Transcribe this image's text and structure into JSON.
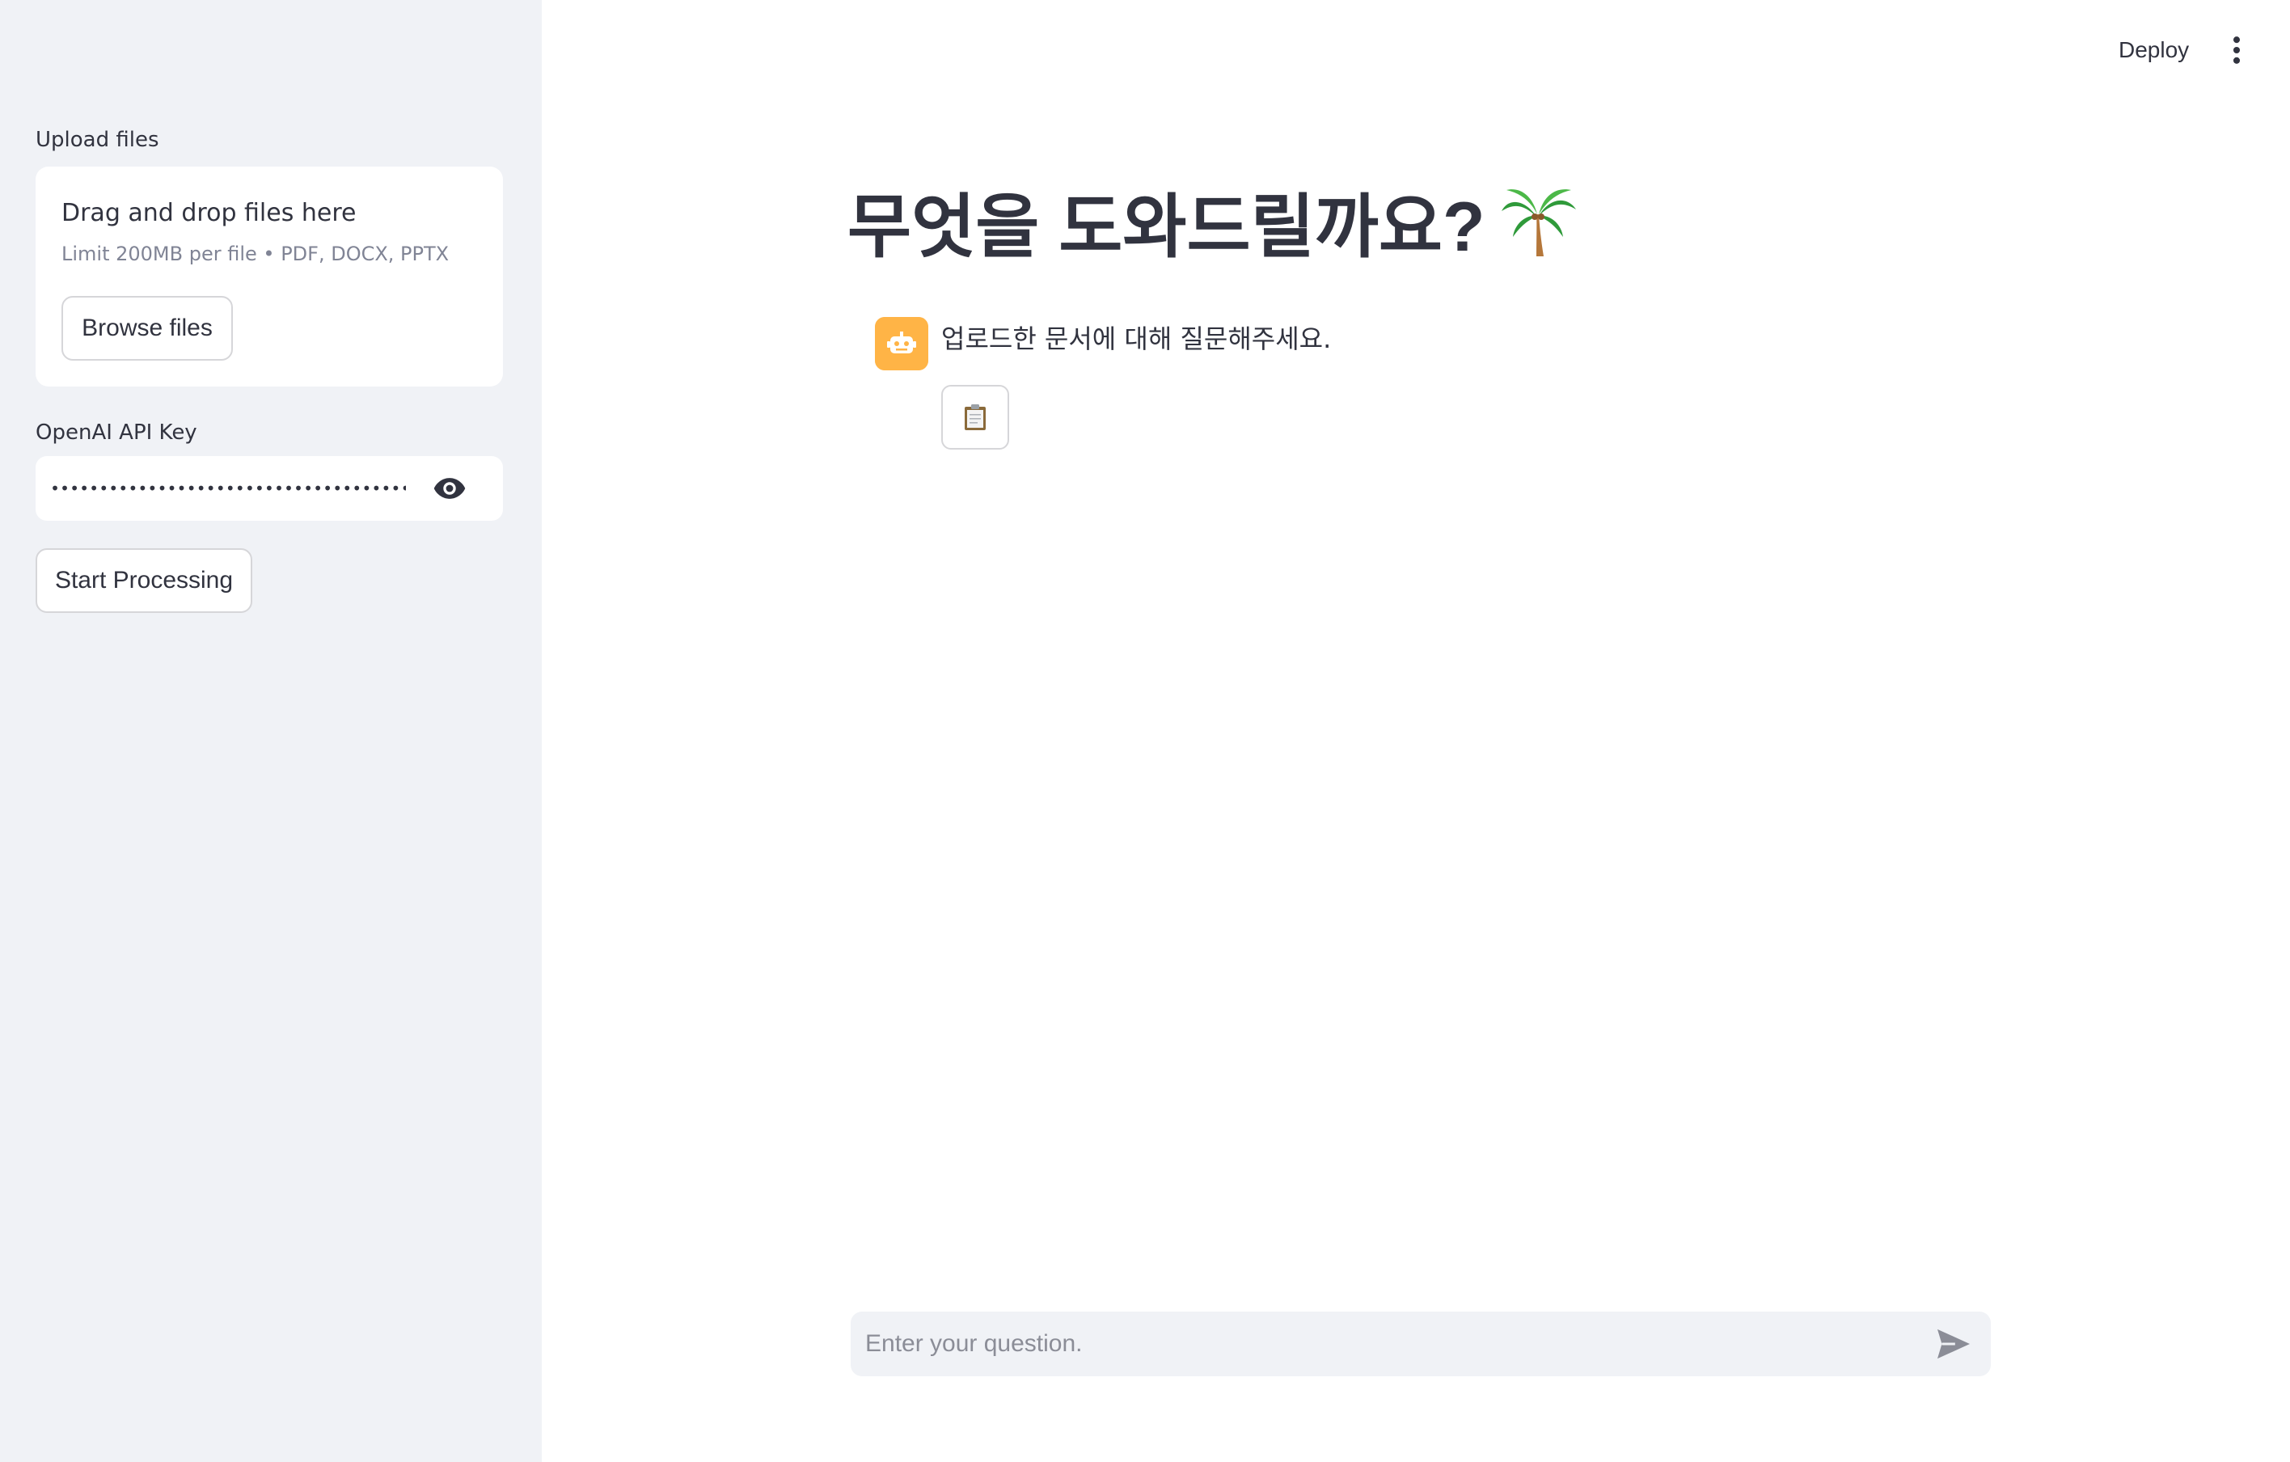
{
  "sidebar": {
    "upload_label": "Upload files",
    "dropzone_title": "Drag and drop files here",
    "dropzone_sub": "Limit 200MB per file • PDF, DOCX, PPTX",
    "browse_label": "Browse files",
    "api_label": "OpenAI API Key",
    "api_value": "••••••••••••••••••••••••••••••••••••••••••••••••••••",
    "start_label": "Start Processing"
  },
  "header": {
    "deploy_label": "Deploy"
  },
  "main": {
    "title": "무엇을 도와드릴까요?",
    "assistant_message": "업로드한 문서에 대해 질문해주세요.",
    "chat_placeholder": "Enter your question."
  },
  "icons": {
    "title_icon": "palm-tree-icon",
    "avatar_icon": "robot-icon",
    "copy_icon": "clipboard-icon",
    "eye_icon": "eye-icon",
    "menu_icon": "kebab-menu-icon",
    "send_icon": "send-icon"
  },
  "colors": {
    "sidebar_bg": "#f0f2f6",
    "avatar_bg": "#ffb446",
    "text": "#31333f",
    "muted": "#808495"
  }
}
